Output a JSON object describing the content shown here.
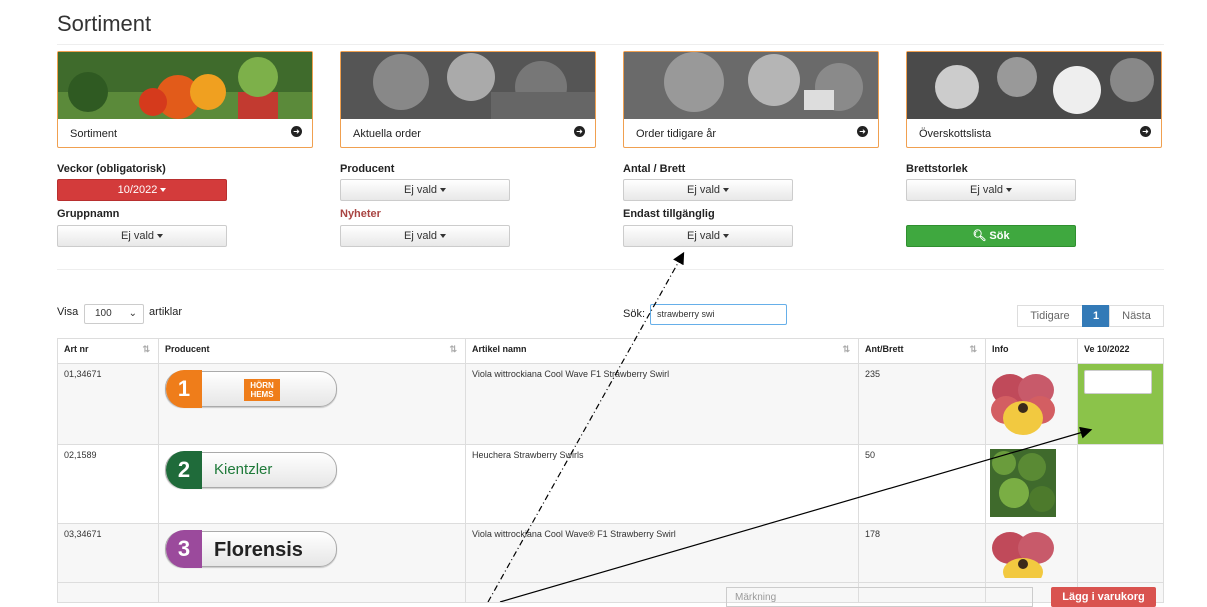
{
  "page": {
    "title": "Sortiment"
  },
  "cards": [
    {
      "label": "Sortiment",
      "icon": "arrow-circle-right-icon"
    },
    {
      "label": "Aktuella order",
      "icon": "arrow-circle-right-icon"
    },
    {
      "label": "Order tidigare år",
      "icon": "arrow-circle-right-icon"
    },
    {
      "label": "Överskottslista",
      "icon": "arrow-circle-right-icon"
    }
  ],
  "filters": {
    "veckor": {
      "label": "Veckor (obligatorisk)",
      "value": "10/2022"
    },
    "producent": {
      "label": "Producent",
      "value": "Ej vald"
    },
    "antal": {
      "label": "Antal / Brett",
      "value": "Ej vald"
    },
    "brettstorlek": {
      "label": "Brettstorlek",
      "value": "Ej vald"
    },
    "gruppnamn": {
      "label": "Gruppnamn",
      "value": "Ej vald"
    },
    "nyheter": {
      "label": "Nyheter",
      "value": "Ej vald"
    },
    "tillganglig": {
      "label": "Endast tillgänglig",
      "value": "Ej vald"
    },
    "search_button": "Sök"
  },
  "list": {
    "show_label": "Visa",
    "show_value": "100",
    "show_suffix": "artiklar",
    "search_label": "Sök:",
    "search_value": "strawberry swi",
    "pager": {
      "prev": "Tidigare",
      "current": "1",
      "next": "Nästa"
    }
  },
  "table": {
    "headers": [
      "Art nr",
      "Producent",
      "Artikel namn",
      "Ant/Brett",
      "Info",
      "Ve 10/2022"
    ],
    "rows": [
      {
        "artnr": "01,34671",
        "logo_num": "1",
        "logo_brand": "HÖRN HEMS",
        "name": "Viola wittrockiana Cool Wave F1 Strawberry Swirl",
        "ant": "235"
      },
      {
        "artnr": "02,1589",
        "logo_num": "2",
        "logo_brand": "Kientzler",
        "name": "Heuchera Strawberry Swirls",
        "ant": "50"
      },
      {
        "artnr": "03,34671",
        "logo_num": "3",
        "logo_brand": "Florensis",
        "name": "Viola wittrockiana Cool Wave® F1 Strawberry Swirl",
        "ant": "178"
      }
    ]
  },
  "footer": {
    "mark_placeholder": "Märkning",
    "cart_button": "Lägg i varukorg"
  },
  "colors": {
    "card_border": "#f0a050",
    "red": "#d33b3b",
    "green": "#3fa83f",
    "cell_green": "#8bc34a",
    "pager_active": "#337ab7"
  }
}
